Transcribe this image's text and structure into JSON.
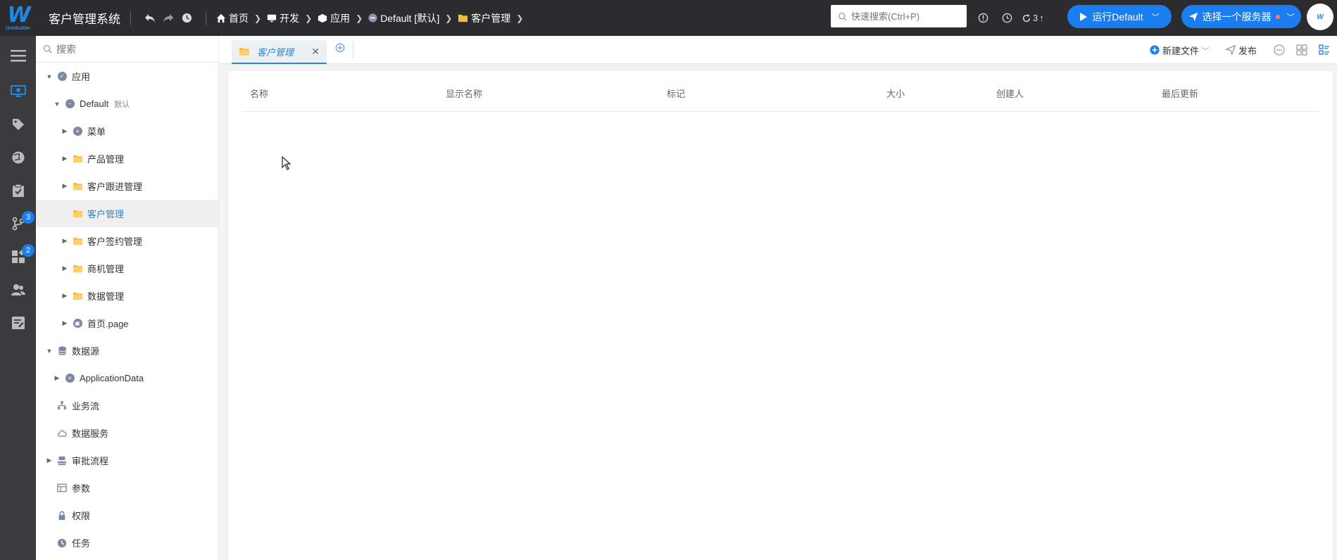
{
  "header": {
    "logo_text": "W",
    "logo_sub": "OneBuilder",
    "app_title": "客户管理系统",
    "breadcrumbs": [
      {
        "label": "首页",
        "icon": "home-icon"
      },
      {
        "label": "开发",
        "icon": "monitor-icon"
      },
      {
        "label": "应用",
        "icon": "cube-icon"
      },
      {
        "label": "Default [默认]",
        "icon": "db-circle-icon"
      },
      {
        "label": "客户管理",
        "icon": "folder-icon"
      }
    ],
    "search_placeholder": "快速搜索(Ctrl+P)",
    "refresh_count": "3",
    "run_button": "运行Default",
    "server_button": "选择一个服务器",
    "colors": {
      "primary": "#1a7ef0",
      "topbar": "#2c2c2e",
      "rail": "#3b3b3d",
      "folder": "#f5b942"
    }
  },
  "rail": {
    "badges": {
      "git": "3",
      "components": "2"
    }
  },
  "sidebar": {
    "search_placeholder": "搜索",
    "app_root": "应用",
    "default_node": "Default",
    "default_tag": "默认",
    "items": [
      {
        "label": "菜单",
        "icon": "menu-circle-icon"
      },
      {
        "label": "产品管理",
        "icon": "folder-icon"
      },
      {
        "label": "客户跟进管理",
        "icon": "folder-icon"
      },
      {
        "label": "客户管理",
        "icon": "folder-icon"
      },
      {
        "label": "客户签约管理",
        "icon": "folder-icon"
      },
      {
        "label": "商机管理",
        "icon": "folder-icon"
      },
      {
        "label": "数据管理",
        "icon": "folder-icon"
      },
      {
        "label": "首页.page",
        "icon": "page-circle-icon"
      }
    ],
    "datasource": "数据源",
    "app_data": "ApplicationData",
    "bottom": [
      {
        "label": "业务流",
        "icon": "flow-icon"
      },
      {
        "label": "数据服务",
        "icon": "cloud-icon"
      },
      {
        "label": "审批流程",
        "icon": "approval-icon"
      },
      {
        "label": "参数",
        "icon": "params-icon"
      },
      {
        "label": "权限",
        "icon": "lock-icon"
      },
      {
        "label": "任务",
        "icon": "clock-icon"
      }
    ]
  },
  "main": {
    "tab_label": "客户管理",
    "toolbar": {
      "new_file": "新建文件",
      "publish": "发布"
    },
    "columns": [
      "名称",
      "显示名称",
      "标记",
      "大小",
      "创建人",
      "最后更新"
    ]
  }
}
